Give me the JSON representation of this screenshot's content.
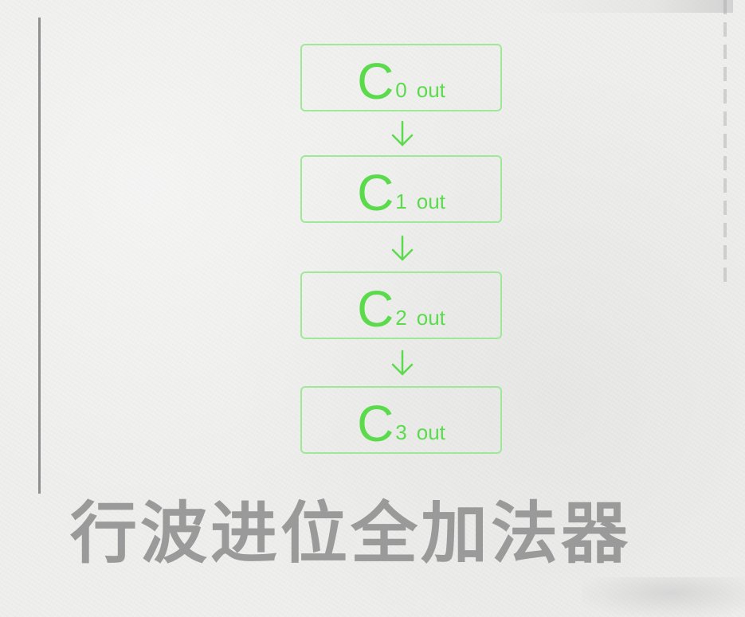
{
  "diagram": {
    "colors": {
      "box_border": "#9ee898",
      "box_text": "#5bdb4c",
      "arrow": "#5bdb4c",
      "title_text": "#9a9a9a",
      "background": "#efefee",
      "left_rule": "#8f8f8f"
    },
    "nodes": [
      {
        "glyph": "C",
        "subscript": "0",
        "suffix": "out"
      },
      {
        "glyph": "C",
        "subscript": "1",
        "suffix": "out"
      },
      {
        "glyph": "C",
        "subscript": "2",
        "suffix": "out"
      },
      {
        "glyph": "C",
        "subscript": "3",
        "suffix": "out"
      }
    ],
    "edges": [
      {
        "from": 0,
        "to": 1,
        "type": "arrow-down"
      },
      {
        "from": 1,
        "to": 2,
        "type": "arrow-down"
      },
      {
        "from": 2,
        "to": 3,
        "type": "arrow-down"
      }
    ]
  },
  "caption": {
    "title": "行波进位全加法器"
  }
}
